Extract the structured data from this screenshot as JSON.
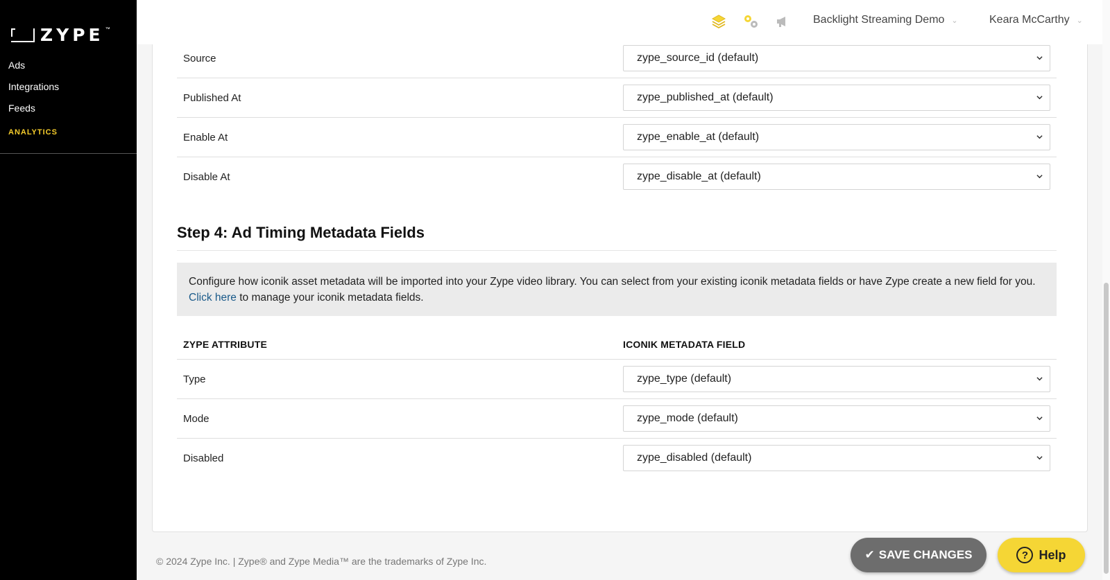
{
  "brand": {
    "logo_text": "ZYPE",
    "logo_tm": "™"
  },
  "sidebar": {
    "items": [
      {
        "label": "Ads"
      },
      {
        "label": "Integrations"
      },
      {
        "label": "Feeds"
      }
    ],
    "section_label": "ANALYTICS"
  },
  "topbar": {
    "icons": [
      "stack-icon",
      "gear-icon",
      "megaphone-icon"
    ],
    "account_select": "Backlight Streaming Demo",
    "user_select": "Keara McCarthy"
  },
  "step3_rows": [
    {
      "label": "Source",
      "value": "zype_source_id (default)"
    },
    {
      "label": "Published At",
      "value": "zype_published_at (default)"
    },
    {
      "label": "Enable At",
      "value": "zype_enable_at (default)"
    },
    {
      "label": "Disable At",
      "value": "zype_disable_at (default)"
    }
  ],
  "step4": {
    "title": "Step 4: Ad Timing Metadata Fields",
    "info_before": "Configure how iconik asset metadata will be imported into your Zype video library. You can select from your existing iconik metadata fields or have Zype create a new field for you.",
    "info_link": "Click here",
    "info_after": "to manage your iconik metadata fields.",
    "col_attribute": "ZYPE ATTRIBUTE",
    "col_field": "ICONIK METADATA FIELD",
    "rows": [
      {
        "label": "Type",
        "value": "zype_type (default)"
      },
      {
        "label": "Mode",
        "value": "zype_mode (default)"
      },
      {
        "label": "Disabled",
        "value": "zype_disabled (default)"
      }
    ]
  },
  "footer": {
    "copyright": "© 2024 Zype Inc. | Zype® and Zype Media™ are the trademarks of Zype Inc.",
    "save_label": "SAVE CHANGES",
    "help_label": "Help"
  },
  "colors": {
    "sidebar_bg": "#000000",
    "accent_yellow": "#f5cc2b",
    "link": "#1a5a8a",
    "save_btn": "#6d6d6d",
    "help_btn": "#f5d635"
  }
}
